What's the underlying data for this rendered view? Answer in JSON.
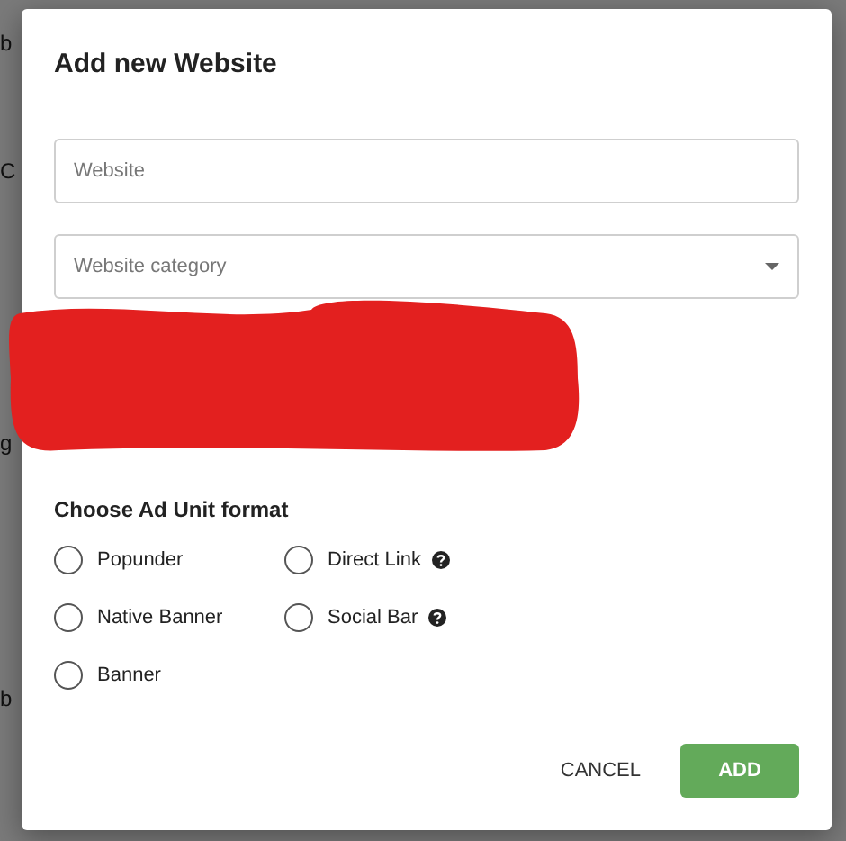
{
  "background": {
    "side_rows": [
      {
        "left": "b"
      },
      {
        "left": "C"
      },
      {
        "left": ""
      },
      {
        "left": "g"
      },
      {
        "left": ""
      },
      {
        "left": "b"
      }
    ]
  },
  "dialog": {
    "title": "Add new Website",
    "website_field": {
      "placeholder": "Website"
    },
    "category_select": {
      "placeholder": "Website category"
    },
    "redacted": true,
    "section_label": "Choose Ad Unit format",
    "format_options": [
      {
        "label": "Popunder",
        "selected": false,
        "help": false
      },
      {
        "label": "Direct Link",
        "selected": false,
        "help": true
      },
      {
        "label": "Native Banner",
        "selected": false,
        "help": false
      },
      {
        "label": "Social Bar",
        "selected": false,
        "help": true
      },
      {
        "label": "Banner",
        "selected": false,
        "help": false
      }
    ],
    "buttons": [
      {
        "label": "CANCEL",
        "kind": "text"
      },
      {
        "label": "ADD",
        "kind": "primary"
      }
    ]
  }
}
